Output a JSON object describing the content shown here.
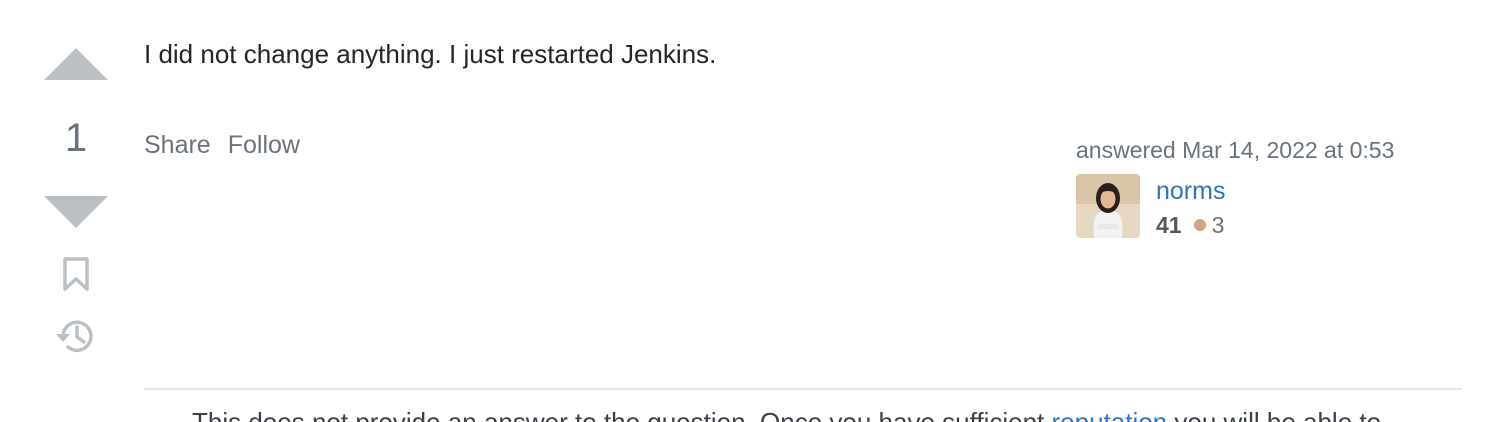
{
  "vote": {
    "count": "1",
    "upvote_icon": "triangle-up-icon",
    "downvote_icon": "triangle-down-icon",
    "bookmark_icon": "bookmark-icon",
    "history_icon": "history-icon"
  },
  "post": {
    "body": "I did not change anything. I just restarted Jenkins."
  },
  "menu": {
    "share_label": "Share",
    "follow_label": "Follow"
  },
  "user_card": {
    "action_time": "answered Mar 14, 2022 at 0:53",
    "user_name": "norms",
    "reputation": "41",
    "bronze_badges": "3",
    "bronze_color": "#d1a684"
  },
  "notice": {
    "text_before": "This does not provide an answer to the question. Once you have sufficient ",
    "link_text": "reputation",
    "text_after": " you will be able to"
  },
  "colors": {
    "link": "#2f74c0",
    "muted": "#6a737c",
    "vote_arrow": "#bbc0c4"
  }
}
